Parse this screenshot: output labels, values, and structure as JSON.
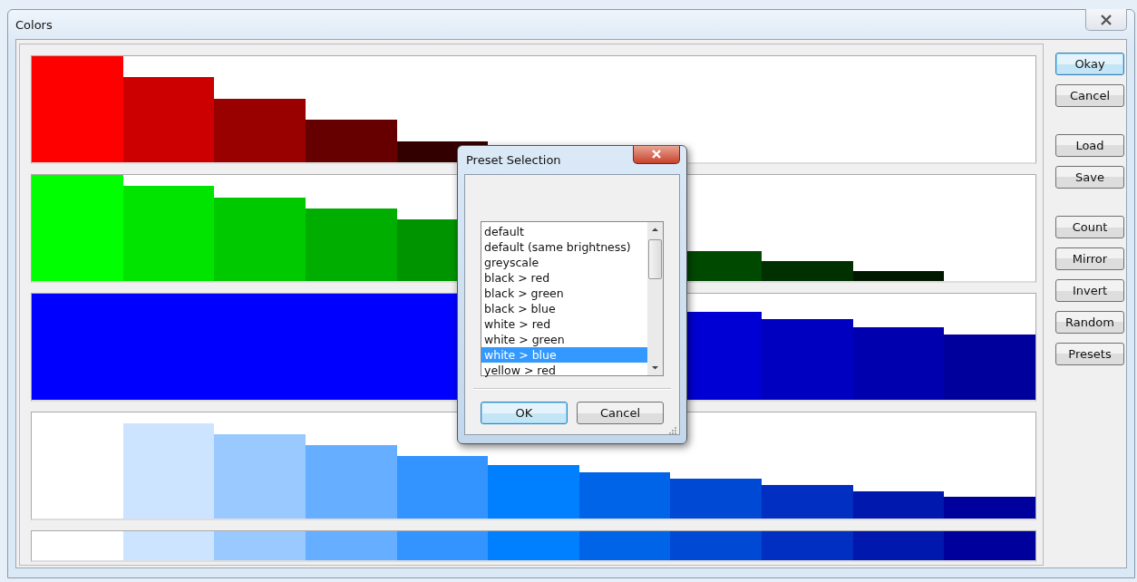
{
  "window": {
    "title": "Colors"
  },
  "palette": [
    {
      "color": "#ffffff"
    },
    {
      "color": "#cce4ff"
    },
    {
      "color": "#99c9ff"
    },
    {
      "color": "#66aeff"
    },
    {
      "color": "#3394ff"
    },
    {
      "color": "#0080ff"
    },
    {
      "color": "#0064e9"
    },
    {
      "color": "#0049d4"
    },
    {
      "color": "#002fc1"
    },
    {
      "color": "#0018ae"
    },
    {
      "color": "#00009d"
    }
  ],
  "button_groups": [
    [
      {
        "label": "Okay",
        "focused": true
      },
      {
        "label": "Cancel",
        "focused": false
      }
    ],
    [
      {
        "label": "Load",
        "focused": false
      },
      {
        "label": "Save",
        "focused": false
      }
    ],
    [
      {
        "label": "Count",
        "focused": false
      },
      {
        "label": "Mirror",
        "focused": false
      },
      {
        "label": "Invert",
        "focused": false
      },
      {
        "label": "Random",
        "focused": false
      },
      {
        "label": "Presets",
        "focused": false
      }
    ]
  ],
  "preset_dialog": {
    "title": "Preset Selection",
    "presets": [
      {
        "label": "default",
        "selected": false
      },
      {
        "label": "default (same brightness)",
        "selected": false
      },
      {
        "label": "greyscale",
        "selected": false
      },
      {
        "label": "black > red",
        "selected": false
      },
      {
        "label": "black > green",
        "selected": false
      },
      {
        "label": "black > blue",
        "selected": false
      },
      {
        "label": "white > red",
        "selected": false
      },
      {
        "label": "white > green",
        "selected": false
      },
      {
        "label": "white > blue",
        "selected": true
      },
      {
        "label": "yellow > red",
        "selected": false
      }
    ],
    "buttons": [
      {
        "label": "OK",
        "focused": true
      },
      {
        "label": "Cancel",
        "focused": false
      }
    ]
  }
}
